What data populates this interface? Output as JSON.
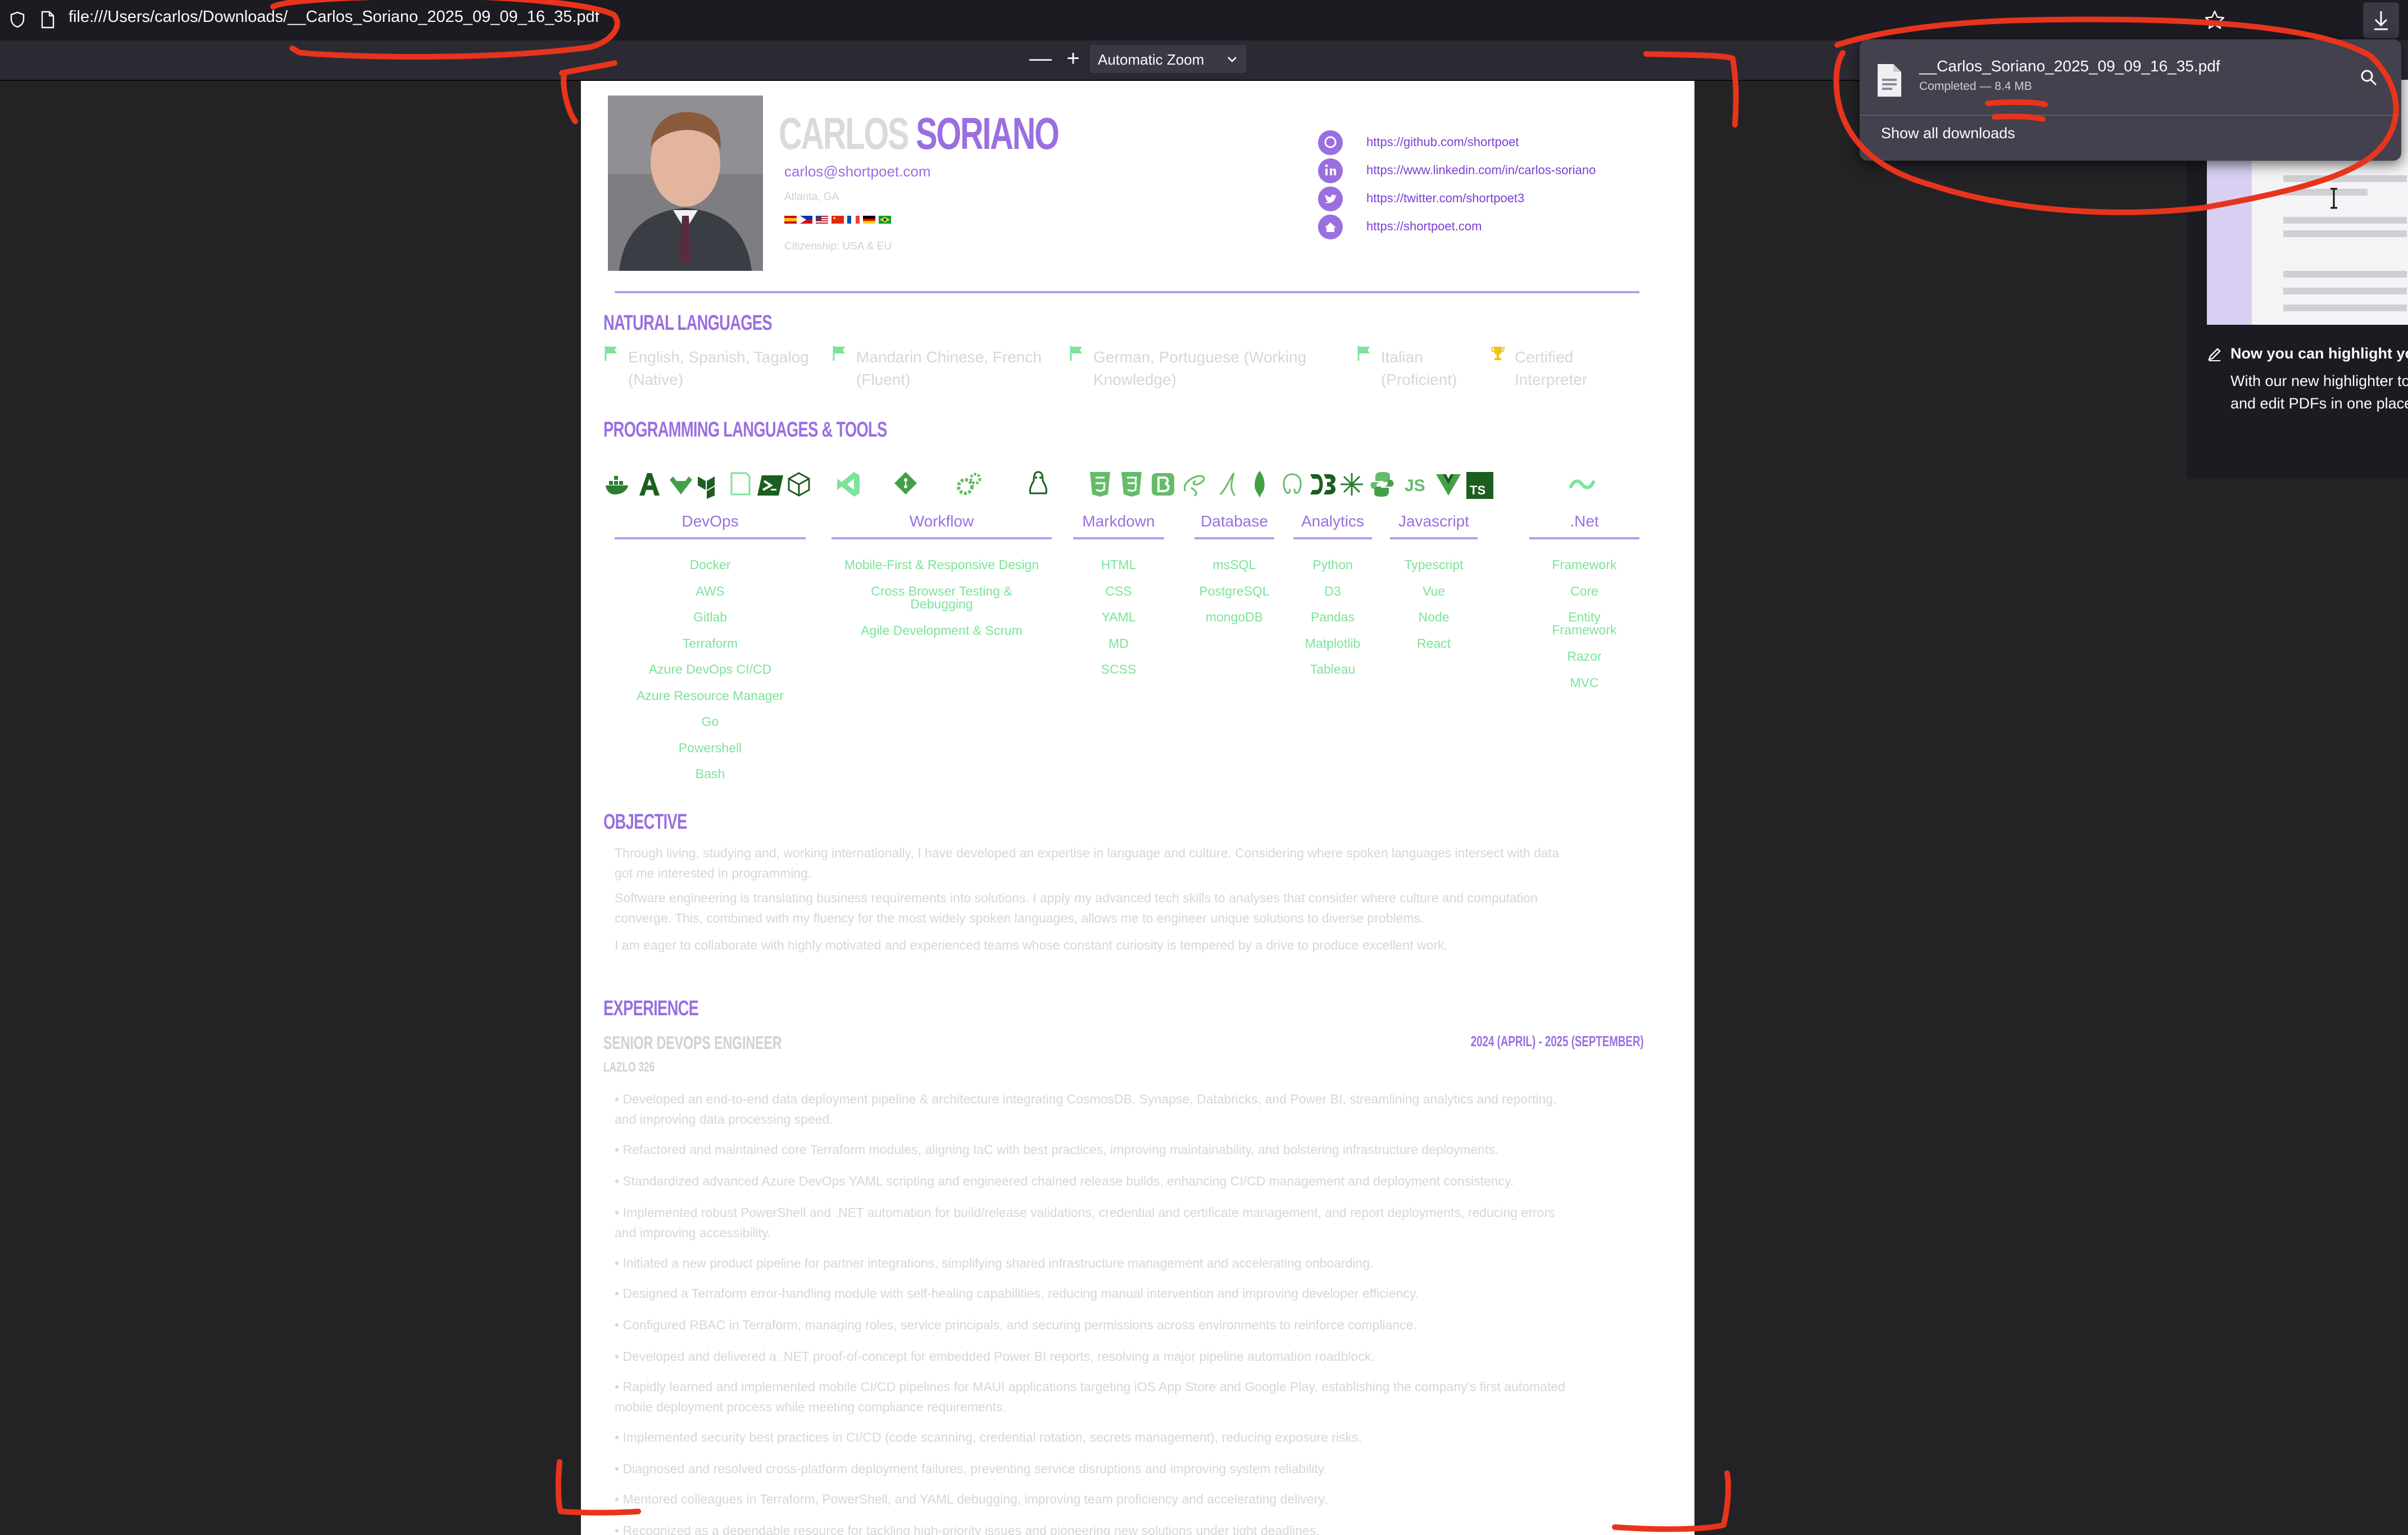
{
  "browser": {
    "url": "file:///Users/carlos/Downloads/__Carlos_Soriano_2025_09_09_16_35.pdf"
  },
  "pdf_toolbar": {
    "zoom_label": "Automatic Zoom",
    "zoom_out": "—",
    "zoom_in": "+"
  },
  "download_panel": {
    "filename": "__Carlos_Soriano_2025_09_09_16_35.pdf",
    "status": "Completed — 8.4 MB",
    "show_all": "Show all downloads"
  },
  "sidebar": {
    "heading": "Now you can highlight you",
    "line1": "With our new highlighter to",
    "line2": "and edit PDFs in one place"
  },
  "resume": {
    "first_name": "CARLOS",
    "last_name": "SORIANO",
    "email": "carlos@shortpoet.com",
    "location": "Atlanta, GA",
    "citizenship": "Citizenship: USA & EU",
    "links": [
      "https://github.com/shortpoet",
      "https://www.linkedin.com/in/carlos-soriano",
      "https://twitter.com/shortpoet3",
      "https://shortpoet.com"
    ],
    "natural_languages_heading": "NATURAL LANGUAGES",
    "natural_languages": [
      {
        "l1": "English, Spanish, Tagalog",
        "l2": "(Native)"
      },
      {
        "l1": "Mandarin Chinese, French",
        "l2": "(Fluent)"
      },
      {
        "l1": "German, Portuguese (Working",
        "l2": "Knowledge)"
      },
      {
        "l1": "Italian",
        "l2": "(Proficient)"
      },
      {
        "l1": "Certified",
        "l2": "Interpreter"
      }
    ],
    "programming_heading": "PROGRAMMING LANGUAGES & TOOLS",
    "categories": [
      {
        "name": "DevOps",
        "items": [
          "Docker",
          "AWS",
          "Gitlab",
          "Terraform",
          "Azure DevOps CI/CD",
          "Azure Resource Manager",
          "Go",
          "Powershell",
          "Bash"
        ]
      },
      {
        "name": "Workflow",
        "items": [
          "Mobile-First & Responsive Design",
          "Cross Browser Testing &",
          "Debugging",
          "Agile Development & Scrum"
        ]
      },
      {
        "name": "Markdown",
        "items": [
          "HTML",
          "CSS",
          "YAML",
          "MD",
          "SCSS"
        ]
      },
      {
        "name": "Database",
        "items": [
          "msSQL",
          "PostgreSQL",
          "mongoDB"
        ]
      },
      {
        "name": "Analytics",
        "items": [
          "Python",
          "D3",
          "Pandas",
          "Matplotlib",
          "Tableau"
        ]
      },
      {
        "name": "Javascript",
        "items": [
          "Typescript",
          "Vue",
          "Node",
          "React"
        ]
      },
      {
        "name": ".Net",
        "items": [
          "Framework",
          "Core",
          "Entity",
          "Framework",
          "Razor",
          "MVC"
        ]
      }
    ],
    "objective_heading": "OBJECTIVE",
    "objective": [
      "Through living, studying and, working internationally, I have developed an expertise in language and culture. Considering where spoken languages intersect with data",
      "got me interested in programming.",
      "Software engineering is translating business requirements into solutions. I apply my advanced tech skills to analyses that consider where culture and computation",
      "converge. This, combined with my fluency for the most widely spoken languages, allows me to engineer unique solutions to diverse problems.",
      "I am eager to collaborate with highly motivated and experienced teams whose constant curiosity is tempered by a drive to produce excellent work."
    ],
    "experience_heading": "EXPERIENCE",
    "job_title": "SENIOR DEVOPS ENGINEER",
    "company": "LAZLO 326",
    "job_dates": "2024 (APRIL) - 2025 (SEPTEMBER)",
    "bullets": [
      "• Developed an end-to-end data deployment pipeline & architecture integrating CosmosDB, Synapse, Databricks, and Power BI, streamlining analytics and reporting,",
      "and improving data processing speed.",
      "• Refactored and maintained core Terraform modules, aligning IaC with best practices, improving maintainability, and bolstering infrastructure deployments.",
      "• Standardized advanced Azure DevOps YAML scripting and engineered chained release builds, enhancing CI/CD management and deployment consistency.",
      "• Implemented robust PowerShell and .NET automation for build/release validations, credential and certificate management, and report deployments, reducing errors",
      "and improving accessibility.",
      "• Initiated a new product pipeline for partner integrations, simplifying shared infrastructure management and accelerating onboarding.",
      "• Designed a Terraform error-handling module with self-healing capabilities, reducing manual intervention and improving developer efficiency.",
      "• Configured RBAC in Terraform, managing roles, service principals, and securing permissions across environments to reinforce compliance.",
      "• Developed and delivered a .NET proof-of-concept for embedded Power BI reports, resolving a major pipeline automation roadblock.",
      "• Rapidly learned and implemented mobile CI/CD pipelines for MAUI applications targeting iOS App Store and Google Play, establishing the company's first automated",
      "mobile deployment process while meeting compliance requirements.",
      "• Implemented security best practices in CI/CD (code scanning, credential rotation, secrets management), reducing exposure risks.",
      "• Diagnosed and resolved cross-platform deployment failures, preventing service disruptions and improving system reliability.",
      "• Mentored colleagues in Terraform, PowerShell, and YAML debugging, improving team proficiency and accelerating delivery.",
      "• Recognized as a dependable resource for tackling high-priority issues and pioneering new solutions under tight deadlines."
    ]
  },
  "colors": {
    "accent": "#9a6fe0",
    "green": "#7ce39b",
    "markup": "#e8341c"
  }
}
